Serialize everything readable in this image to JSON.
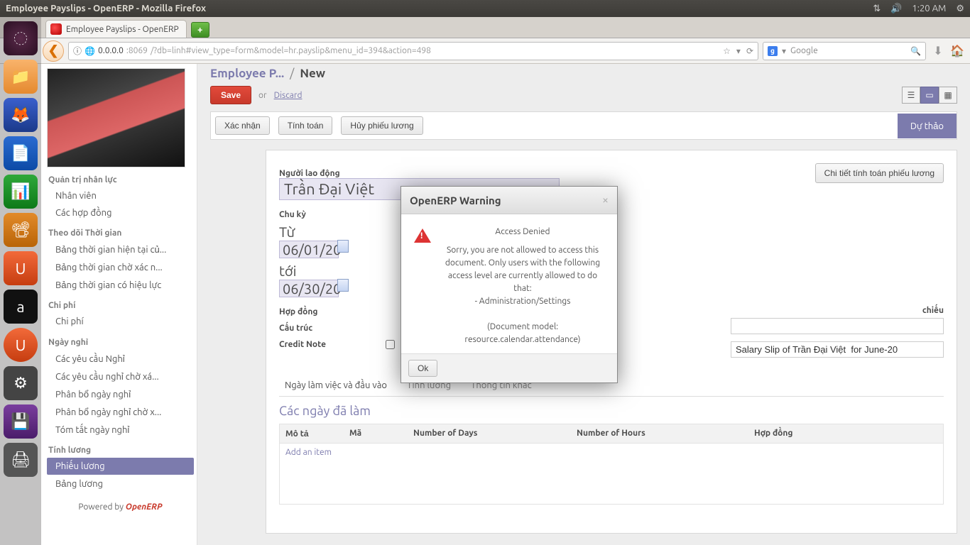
{
  "os": {
    "window_title": "Employee Payslips - OpenERP - Mozilla Firefox",
    "clock": "1:20 AM"
  },
  "browser": {
    "tab_title": "Employee Payslips - OpenERP",
    "url_host": "0.0.0.0",
    "url_port": ":8069",
    "url_path": "/?db=linh#view_type=form&model=hr.payslip&menu_id=394&action=498",
    "search_placeholder": "Google"
  },
  "sidebar": {
    "categories": [
      {
        "title": "Quản trị nhân lực",
        "items": [
          "Nhân viên",
          "Các hợp đồng"
        ]
      },
      {
        "title": "Theo dõi Thời gian",
        "items": [
          "Bảng thời gian hiện tại củ...",
          "Bảng thời gian chờ xác n...",
          "Bảng thời gian có hiệu lực"
        ]
      },
      {
        "title": "Chi phí",
        "items": [
          "Chi phí"
        ]
      },
      {
        "title": "Ngày nghỉ",
        "items": [
          "Các yêu cầu Nghỉ",
          "Các yêu cầu nghỉ chờ xá...",
          "Phân bổ ngày nghỉ",
          "Phân bổ ngày nghỉ chờ x...",
          "Tóm tắt ngày nghỉ"
        ]
      },
      {
        "title": "Tính lương",
        "items": [
          "Phiếu lương",
          "Bảng lương"
        ]
      }
    ],
    "active": "Phiếu lương",
    "powered_prefix": "Powered by ",
    "powered_brand": "OpenERP"
  },
  "breadcrumb": {
    "a": "Employee P...",
    "b": "New"
  },
  "actions": {
    "save": "Save",
    "or": "or",
    "discard": "Discard"
  },
  "workflow": {
    "buttons": [
      "Xác nhận",
      "Tính toán",
      "Hủy phiếu lương"
    ],
    "status": "Dự thảo"
  },
  "form": {
    "detail_btn": "Chi tiết tính toán phiếu lương",
    "employee_label": "Người lao động",
    "employee_value": "Trần Đại Việt",
    "period_label": "Chu kỳ",
    "from_label": "Từ",
    "from_value": "06/01/20",
    "to_label": "tới",
    "to_value": "06/30/20",
    "contract_label": "Hợp đồng",
    "structure_label": "Cấu trúc",
    "credit_note_label": "Credit Note",
    "reference_label": "Tham chiếu",
    "name_value": "Salary Slip of Trần Đại Việt  for June-20",
    "tabs": [
      "Ngày làm việc và đầu vào",
      "Tính lương",
      "Thông tin khác"
    ],
    "section_title": "Các ngày đã làm",
    "grid_headers": [
      "Mô tả",
      "Mã",
      "Number of Days",
      "Number of Hours",
      "Hợp đồng"
    ],
    "add_item": "Add an item"
  },
  "modal": {
    "title": "OpenERP Warning",
    "heading": "Access Denied",
    "line1": "Sorry, you are not allowed to access this document. Only users with the following access level are currently allowed to do that:",
    "line2": "- Administration/Settings",
    "line3": "(Document model: resource.calendar.attendance)",
    "ok": "Ok"
  }
}
